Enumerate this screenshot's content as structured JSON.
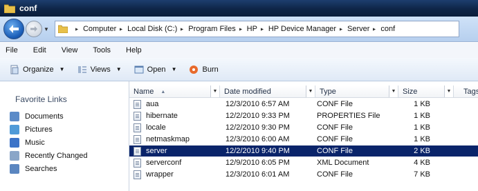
{
  "window": {
    "title": "conf"
  },
  "address": {
    "crumbs": [
      "Computer",
      "Local Disk (C:)",
      "Program Files",
      "HP",
      "HP Device Manager",
      "Server",
      "conf"
    ]
  },
  "menu": [
    "File",
    "Edit",
    "View",
    "Tools",
    "Help"
  ],
  "toolbar": {
    "organize": "Organize",
    "views": "Views",
    "open": "Open",
    "burn": "Burn"
  },
  "sidebar": {
    "heading": "Favorite Links",
    "items": [
      {
        "label": "Documents",
        "color": "#5b8bc8"
      },
      {
        "label": "Pictures",
        "color": "#4f9ad8"
      },
      {
        "label": "Music",
        "color": "#3b73c8"
      },
      {
        "label": "Recently Changed",
        "color": "#8aa6c8"
      },
      {
        "label": "Searches",
        "color": "#5a86c0"
      }
    ]
  },
  "columns": [
    "Name",
    "Date modified",
    "Type",
    "Size",
    "Tags"
  ],
  "files": [
    {
      "name": "aua",
      "date": "12/3/2010 6:57 AM",
      "type": "CONF File",
      "size": "1 KB",
      "selected": false
    },
    {
      "name": "hibernate",
      "date": "12/2/2010 9:33 PM",
      "type": "PROPERTIES File",
      "size": "1 KB",
      "selected": false
    },
    {
      "name": "locale",
      "date": "12/2/2010 9:30 PM",
      "type": "CONF File",
      "size": "1 KB",
      "selected": false
    },
    {
      "name": "netmaskmap",
      "date": "12/3/2010 6:00 AM",
      "type": "CONF File",
      "size": "1 KB",
      "selected": false
    },
    {
      "name": "server",
      "date": "12/2/2010 9:40 PM",
      "type": "CONF File",
      "size": "2 KB",
      "selected": true
    },
    {
      "name": "serverconf",
      "date": "12/9/2010 6:05 PM",
      "type": "XML Document",
      "size": "4 KB",
      "selected": false
    },
    {
      "name": "wrapper",
      "date": "12/3/2010 6:01 AM",
      "type": "CONF File",
      "size": "7 KB",
      "selected": false
    }
  ],
  "colors": {
    "titlebar": "#0e2547",
    "selection": "#0a246a",
    "folder": "#e8c04a"
  }
}
